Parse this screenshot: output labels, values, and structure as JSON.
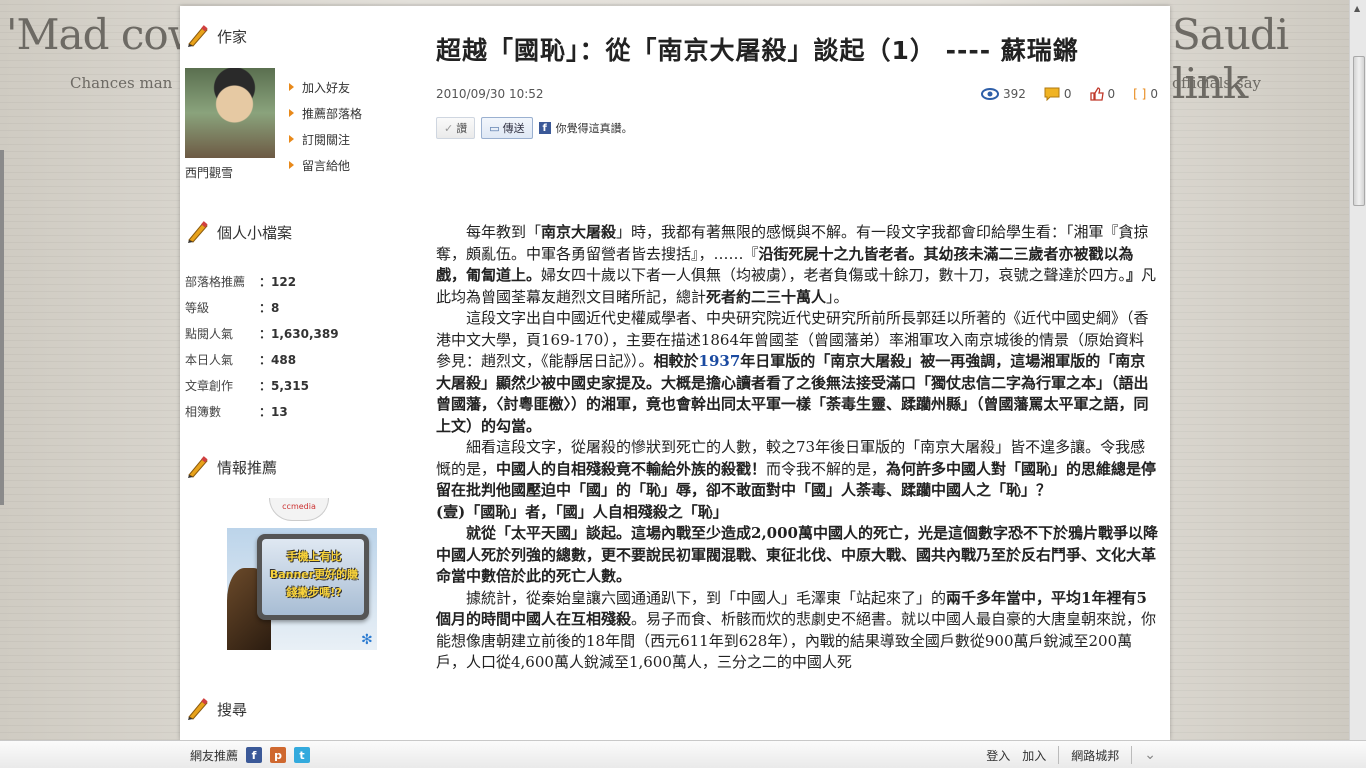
{
  "background": {
    "headline_left": "'Mad cow",
    "headline_right": "Saudi link",
    "sub_left": "Chances man",
    "sub_right": "officials say"
  },
  "sidebar": {
    "author_heading": "作家",
    "author_name": "西門觀雪",
    "links": [
      "加入好友",
      "推薦部落格",
      "訂閱關注",
      "留言給他"
    ],
    "profile_heading": "個人小檔案",
    "stats": [
      {
        "label": "部落格推薦",
        "value": "122"
      },
      {
        "label": "等級",
        "value": "8"
      },
      {
        "label": "點閱人氣",
        "value": "1,630,389"
      },
      {
        "label": "本日人氣",
        "value": "488"
      },
      {
        "label": "文章創作",
        "value": "5,315"
      },
      {
        "label": "相簿數",
        "value": "13"
      }
    ],
    "info_heading": "情報推薦",
    "promo_brand": "ccmedia",
    "promo_text": "手機上有比Banner更好的賺錢撇步嗎!?",
    "search_heading": "搜尋"
  },
  "article": {
    "title": "超越「國恥」：從「南京大屠殺」談起（1） ---- 蘇瑞鏘",
    "datetime": "2010/09/30 10:52",
    "views": "392",
    "comments": "0",
    "likes": "0",
    "quotes": "0",
    "btn_like": "讚",
    "btn_share": "傳送",
    "fb_text": "你覺得這真讚。",
    "p1a": "每年教到「",
    "p1b": "南京大屠殺",
    "p1c": "」時，我都有著無限的感慨與不解。有一段文字我都會印給學生看：「湘軍『貪掠奪，頗亂伍。中軍各勇留營者皆去搜括』，……『",
    "p1d": "沿街死屍十之九皆老者。其幼孩未滿二三歲者亦被戳以為戲，匍匐道上。",
    "p1e": "婦女四十歲以下者一人俱無（均被虜），老者負傷或十餘刀，數十刀，哀號之聲達於四方。",
    "p1f": "』",
    "p1g": "凡此均為曾國荃幕友趙烈文目睹所記，總計",
    "p1h": "死者約二三十萬人",
    "p1i": "」。",
    "p2a": "這段文字出自中國近代史權威學者、中央研究院近代史研究所前所長郭廷以所著的《近代中國史綱》（香港中文大學，頁169-170），主要在描述1864年曾國荃（曾國藩弟）率湘軍攻入南京城後的情景（原始資料參見：趙烈文，《能靜居日記》）。",
    "p2b": "相較於",
    "p2c": "1937",
    "p2d": "年日軍版的「南京大屠殺」被一再強調，這場湘軍版的「南京大屠殺」顯然少被中國史家提及。大概是擔心讀者看了之後無法接受滿口「獨仗忠信二字為行軍之本」（語出曾國藩，〈討粵匪檄〉）的湘軍，竟也會幹出同太平軍一樣「荼毒生靈、蹂躪州縣」（曾國藩罵太平軍之語，同上文）的勾當。",
    "p3a": "細看這段文字，從屠殺的慘狀到死亡的人數，較之73年後日軍版的「南京大屠殺」皆不遑多讓。令我感慨的是，",
    "p3b": "中國人的自相殘殺竟不輸給外族的殺戳！",
    "p3c": "而令我不解的是，",
    "p3d": "為何許多中國人對「國恥」的思維總是停留在批判他國壓迫中「國」的「恥」辱，卻不敢面對中「國」人荼毒、蹂躪中國人之「恥」？",
    "p4": "(壹)「國恥」者，「國」人自相殘殺之「恥」",
    "p5a": "就從「太平天國」談起。",
    "p5b": "這場內戰至少造成2,000萬中國人的死亡，光是這個數字恐不下於鴉片戰爭以降中國人死於列強的總數，更不要說民初軍閥混戰、東征北伐、中原大戰、國共內戰乃至於反右鬥爭、文化大革命當中數倍於此的死亡人數。",
    "p6a": "據統計，從秦始皇讓六國通通趴下，到「中國人」毛澤東「站起來了」的",
    "p6b": "兩千多年當中，平均1年裡有5個月的時間中國人在互相殘殺",
    "p6c": "。易子而食、析骸而炊的悲劇史不絕書。就以中國人最自豪的大唐皇朝來說，你能想像唐朝建立前後的18年間（西元611年到628年），內戰的結果導致全國戶數從900萬戶銳減至200萬戶，人口從4,600萬人銳減至1,600萬人，三分之二的中國人死"
  },
  "bottombar": {
    "recommend": "網友推薦",
    "login": "登入",
    "join": "加入",
    "city": "網路城邦"
  }
}
